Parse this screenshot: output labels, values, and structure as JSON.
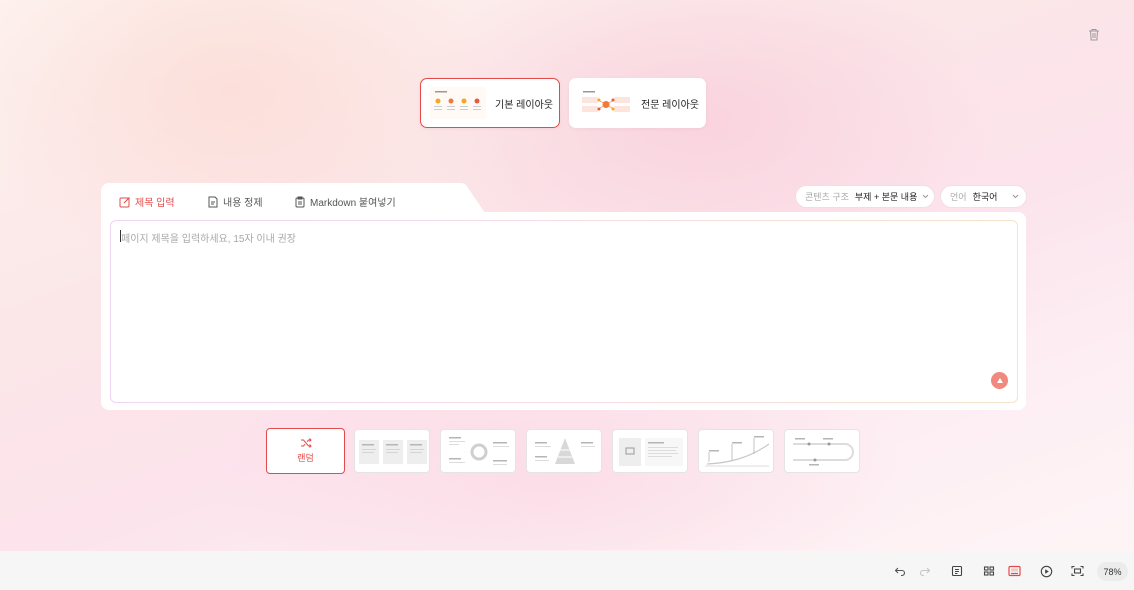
{
  "layouts": {
    "basic_label": "기본 레이아웃",
    "pro_label": "전문 레이아웃"
  },
  "tabs": {
    "title_input": "제목 입력",
    "content_organize": "내용 정제",
    "markdown_paste": "Markdown 붙여넣기"
  },
  "options": {
    "structure_label": "콘텐츠 구조",
    "structure_value": "부제 + 본문 내용",
    "language_label": "언어",
    "language_value": "한국어"
  },
  "editor": {
    "placeholder": "페이지 제목을 입력하세요, 15자 이내 권장",
    "value": ""
  },
  "templates": {
    "random_label": "랜덤"
  },
  "toolbar": {
    "zoom": "78%"
  },
  "colors": {
    "accent": "#e34a4a",
    "send_button": "#f08a7e"
  },
  "icons": [
    "trash-icon",
    "edit-icon",
    "document-icon",
    "clipboard-icon",
    "chevron-down-icon",
    "arrow-up-icon",
    "shuffle-icon",
    "undo-icon",
    "redo-icon",
    "notes-icon",
    "grid-icon",
    "slide-icon",
    "play-icon",
    "fit-screen-icon"
  ]
}
